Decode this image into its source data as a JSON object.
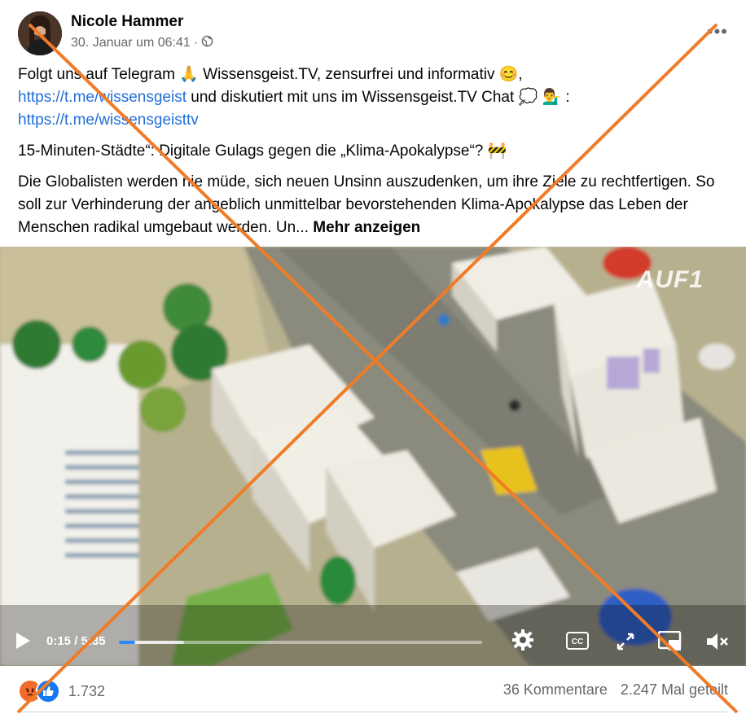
{
  "post": {
    "author": "Nicole Hammer",
    "timestamp": "30. Januar um 06:41",
    "separator": "·",
    "audience_icon": "globe-icon",
    "more_label": "•••",
    "line1_text": "Folgt uns auf Telegram 🙏 Wissensgeist.TV, zensurfrei und informativ 😊,",
    "link1": "https://t.me/wissensgeist",
    "line2_mid": " und diskutiert mit uns im Wissensgeist.TV Chat 💭 💁‍♂️ :",
    "link2": "https://t.me/wissensgeisttv",
    "headline": "15-Minuten-Städte“: Digitale Gulags gegen die „Klima-Apokalypse“? 🚧",
    "description": "Die Globalisten werden nie müde, sich neuen Unsinn auszudenken, um ihre Ziele zu rechtfertigen. So soll zur Verhinderung der angeblich unmittelbar bevorstehenden Klima-Apokalypse das Leben der Menschen radikal umgebaut werden. Un...",
    "see_more": "Mehr anzeigen"
  },
  "video": {
    "watermark": "AUF1",
    "time": "0:15 / 5:35",
    "progress": 0.045,
    "buffered": 0.18
  },
  "footer": {
    "reaction_count": "1.732",
    "comments": "36 Kommentare",
    "shares": "2.247 Mal geteilt"
  },
  "colors": {
    "cross": "#f07c28",
    "link": "#216fdb",
    "progress": "#2d88ff"
  }
}
